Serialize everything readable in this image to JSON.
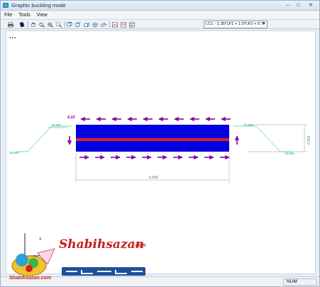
{
  "window": {
    "title": "Graphic buckling mode"
  },
  "menubar": {
    "items": [
      "File",
      "Tools",
      "View"
    ]
  },
  "toolbar": {
    "load_combination": "LC1 - 1.35*LF1 + 1.5*LF2 + 0.7I",
    "icons": [
      "print-icon",
      "book-icon",
      "pan-hand-icon",
      "zoom-icon",
      "zoom-out-icon",
      "zoom-window-icon",
      "view-front-icon",
      "view-top-icon",
      "view-side-icon",
      "view-3d-icon",
      "rotate-icon",
      "buckling-mode-icon",
      "deformed-shape-icon",
      "values-icon"
    ]
  },
  "client": {
    "ellipsis": "..."
  },
  "drawing": {
    "load_factor_label": "4.22",
    "dim_left_top": "15.550",
    "dim_left_bottom": "15.550",
    "dim_right_top": "15.550",
    "dim_right_bottom": "15.550",
    "height_dim": "0.314",
    "length_dim": "6.000",
    "colors": {
      "beam": "#0000e0",
      "highlight": "#e0202a",
      "arrows": "#8a00a8",
      "dimensions": "#00b36b"
    }
  },
  "status": {
    "num": "NUM"
  },
  "watermark": {
    "logo_text": "Shabihsazan",
    "logo_suffix": ".com",
    "logo_sub": "Shabihsazan.com"
  }
}
